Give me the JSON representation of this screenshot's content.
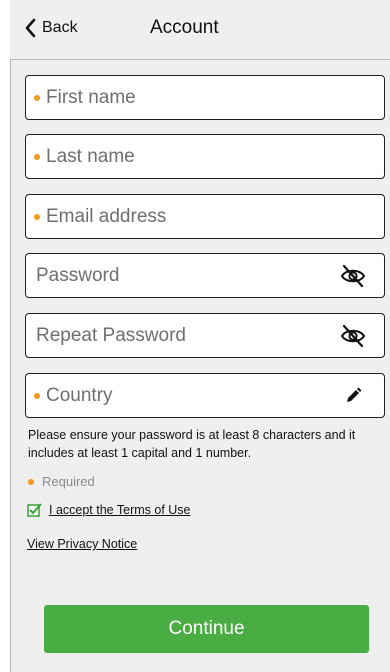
{
  "header": {
    "back_label": "Back",
    "title": "Account",
    "back_icon": "chevron-left-icon"
  },
  "form": {
    "first_name": {
      "placeholder": "First name",
      "required": true
    },
    "last_name": {
      "placeholder": "Last name",
      "required": true
    },
    "email": {
      "placeholder": "Email address",
      "required": true
    },
    "password": {
      "placeholder": "Password",
      "required": false,
      "icon": "eye-slash-icon"
    },
    "repeat_password": {
      "placeholder": "Repeat Password",
      "required": false,
      "icon": "eye-slash-icon"
    },
    "country": {
      "placeholder": "Country",
      "required": true,
      "icon": "pencil-icon"
    }
  },
  "info_text": "Please ensure your password is at least 8 characters and it includes at least 1 capital and 1 number.",
  "required_label": "Required",
  "terms": {
    "label": "I accept the Terms of Use",
    "checked": true
  },
  "privacy_label": "View Privacy Notice",
  "continue_label": "Continue",
  "colors": {
    "required_dot": "#f29a1f",
    "continue_button": "#49ad44",
    "checkbox_check": "#3aa13a",
    "background": "#efefef"
  }
}
